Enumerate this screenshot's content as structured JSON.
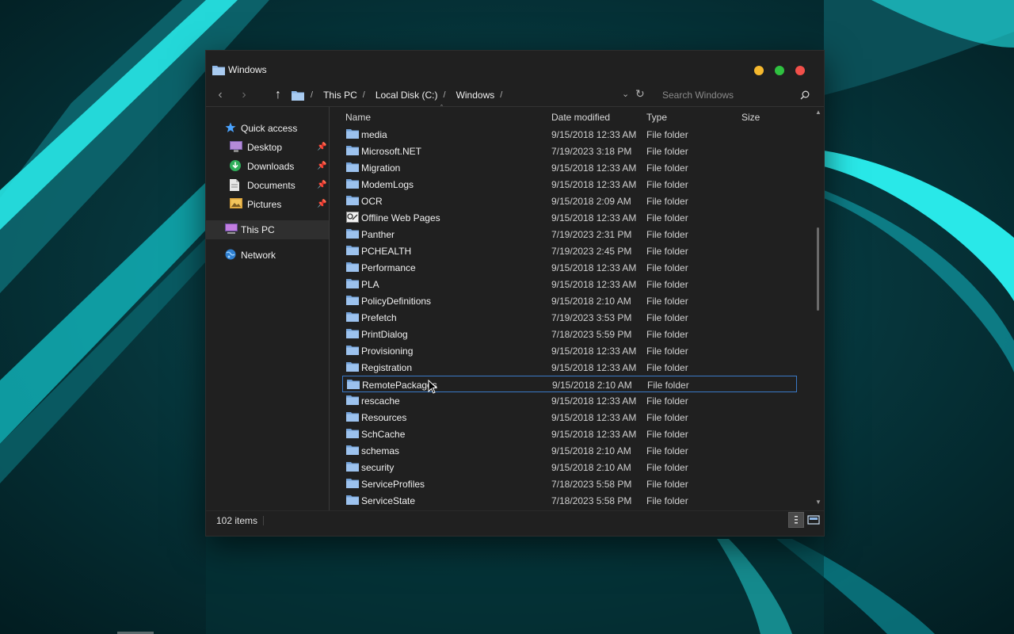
{
  "window": {
    "title": "Windows"
  },
  "nav": {
    "breadcrumbs": [
      "This PC",
      "Local Disk (C:)",
      "Windows"
    ],
    "search_placeholder": "Search Windows"
  },
  "sidebar": {
    "items": [
      {
        "label": "Quick access",
        "icon": "star-icon",
        "color": "#4aa3ff"
      },
      {
        "label": "Desktop",
        "icon": "desktop-icon",
        "pinned": true
      },
      {
        "label": "Downloads",
        "icon": "downloads-icon",
        "pinned": true
      },
      {
        "label": "Documents",
        "icon": "documents-icon",
        "pinned": true
      },
      {
        "label": "Pictures",
        "icon": "pictures-icon",
        "pinned": true
      },
      {
        "label": "This PC",
        "icon": "computer-icon",
        "selected": true
      },
      {
        "label": "Network",
        "icon": "network-icon"
      }
    ]
  },
  "columns": {
    "name": "Name",
    "date": "Date modified",
    "type": "Type",
    "size": "Size"
  },
  "files": [
    {
      "name": "media",
      "date": "9/15/2018 12:33 AM",
      "type": "File folder"
    },
    {
      "name": "Microsoft.NET",
      "date": "7/19/2023 3:18 PM",
      "type": "File folder"
    },
    {
      "name": "Migration",
      "date": "9/15/2018 12:33 AM",
      "type": "File folder"
    },
    {
      "name": "ModemLogs",
      "date": "9/15/2018 12:33 AM",
      "type": "File folder"
    },
    {
      "name": "OCR",
      "date": "9/15/2018 2:09 AM",
      "type": "File folder"
    },
    {
      "name": "Offline Web Pages",
      "date": "9/15/2018 12:33 AM",
      "type": "File folder",
      "special_icon": true
    },
    {
      "name": "Panther",
      "date": "7/19/2023 2:31 PM",
      "type": "File folder"
    },
    {
      "name": "PCHEALTH",
      "date": "7/19/2023 2:45 PM",
      "type": "File folder"
    },
    {
      "name": "Performance",
      "date": "9/15/2018 12:33 AM",
      "type": "File folder"
    },
    {
      "name": "PLA",
      "date": "9/15/2018 12:33 AM",
      "type": "File folder"
    },
    {
      "name": "PolicyDefinitions",
      "date": "9/15/2018 2:10 AM",
      "type": "File folder"
    },
    {
      "name": "Prefetch",
      "date": "7/19/2023 3:53 PM",
      "type": "File folder"
    },
    {
      "name": "PrintDialog",
      "date": "7/18/2023 5:59 PM",
      "type": "File folder"
    },
    {
      "name": "Provisioning",
      "date": "9/15/2018 12:33 AM",
      "type": "File folder"
    },
    {
      "name": "Registration",
      "date": "9/15/2018 12:33 AM",
      "type": "File folder"
    },
    {
      "name": "RemotePackages",
      "date": "9/15/2018 2:10 AM",
      "type": "File folder",
      "focused": true
    },
    {
      "name": "rescache",
      "date": "9/15/2018 12:33 AM",
      "type": "File folder"
    },
    {
      "name": "Resources",
      "date": "9/15/2018 12:33 AM",
      "type": "File folder"
    },
    {
      "name": "SchCache",
      "date": "9/15/2018 12:33 AM",
      "type": "File folder"
    },
    {
      "name": "schemas",
      "date": "9/15/2018 2:10 AM",
      "type": "File folder"
    },
    {
      "name": "security",
      "date": "9/15/2018 2:10 AM",
      "type": "File folder"
    },
    {
      "name": "ServiceProfiles",
      "date": "7/18/2023 5:58 PM",
      "type": "File folder"
    },
    {
      "name": "ServiceState",
      "date": "7/18/2023 5:58 PM",
      "type": "File folder"
    }
  ],
  "status": {
    "item_count": "102 items"
  },
  "colors": {
    "accent": "#3a79c7",
    "folder": "#8cb6e6",
    "window_bg": "#202020"
  }
}
